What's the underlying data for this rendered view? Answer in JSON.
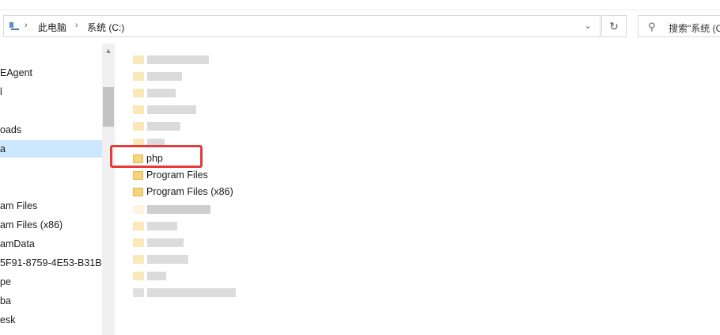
{
  "address_bar": {
    "breadcrumbs": [
      "此电脑",
      "系统 (C:)"
    ],
    "search_placeholder": "搜索\"系统 (C:)\""
  },
  "nav_pane": {
    "items": [
      {
        "label": "",
        "selected": false
      },
      {
        "label": "EAgent",
        "selected": false
      },
      {
        "label": "l",
        "selected": false
      },
      {
        "label": "",
        "selected": false
      },
      {
        "label": "oads",
        "selected": false
      },
      {
        "label": "a",
        "selected": true
      },
      {
        "label": "",
        "selected": false
      },
      {
        "label": "",
        "selected": false
      },
      {
        "label": "am Files",
        "selected": false
      },
      {
        "label": "am Files (x86)",
        "selected": false
      },
      {
        "label": "amData",
        "selected": false
      },
      {
        "label": "5F91-8759-4E53-B31B",
        "selected": false
      },
      {
        "label": "pe",
        "selected": false
      },
      {
        "label": "ba",
        "selected": false
      },
      {
        "label": "esk",
        "selected": false
      }
    ]
  },
  "file_list": {
    "visible_folders": [
      "php",
      "Program Files",
      "Program Files (x86)"
    ]
  },
  "colors": {
    "highlight": "#e53b3b",
    "selected_bg": "#cce8ff",
    "folder": "#f5d47a"
  }
}
